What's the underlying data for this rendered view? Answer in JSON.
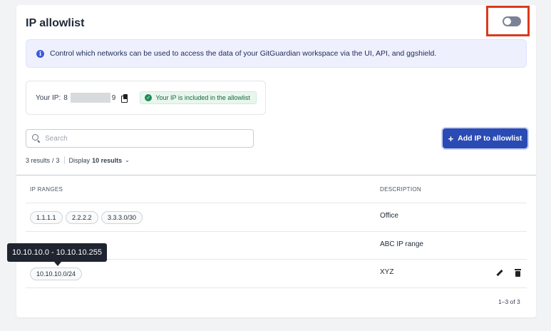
{
  "page": {
    "title": "IP allowlist",
    "info_text": "Control which networks can be used to access the data of your GitGuardian workspace via the UI, API, and ggshield.",
    "toggle": {
      "enabled": false
    }
  },
  "my_ip": {
    "label": "Your IP:",
    "visible_start": "8",
    "visible_end": "9",
    "badge": "Your IP is included in the allowlist"
  },
  "toolbar": {
    "search_placeholder": "Search",
    "add_button": "Add IP to allowlist"
  },
  "results": {
    "count": "3 results",
    "slash": "/",
    "total": "3",
    "display_label": "Display",
    "display_value": "10 results"
  },
  "table": {
    "headers": [
      "IP RANGES",
      "DESCRIPTION"
    ],
    "rows": [
      {
        "ips": [
          "1.1.1.1",
          "2.2.2.2",
          "3.3.3.0/30"
        ],
        "description": "Office"
      },
      {
        "ips": [],
        "description": "ABC IP range"
      },
      {
        "ips": [
          "10.10.10.0/24"
        ],
        "description": "XYZ"
      }
    ]
  },
  "tooltip": "10.10.10.0 - 10.10.10.255",
  "pagination": "1–3 of 3",
  "colors": {
    "primary": "#2a4bb4",
    "highlight_border": "#d93a1c",
    "success": "#1e8b55",
    "info_bg": "#eef0fd"
  }
}
